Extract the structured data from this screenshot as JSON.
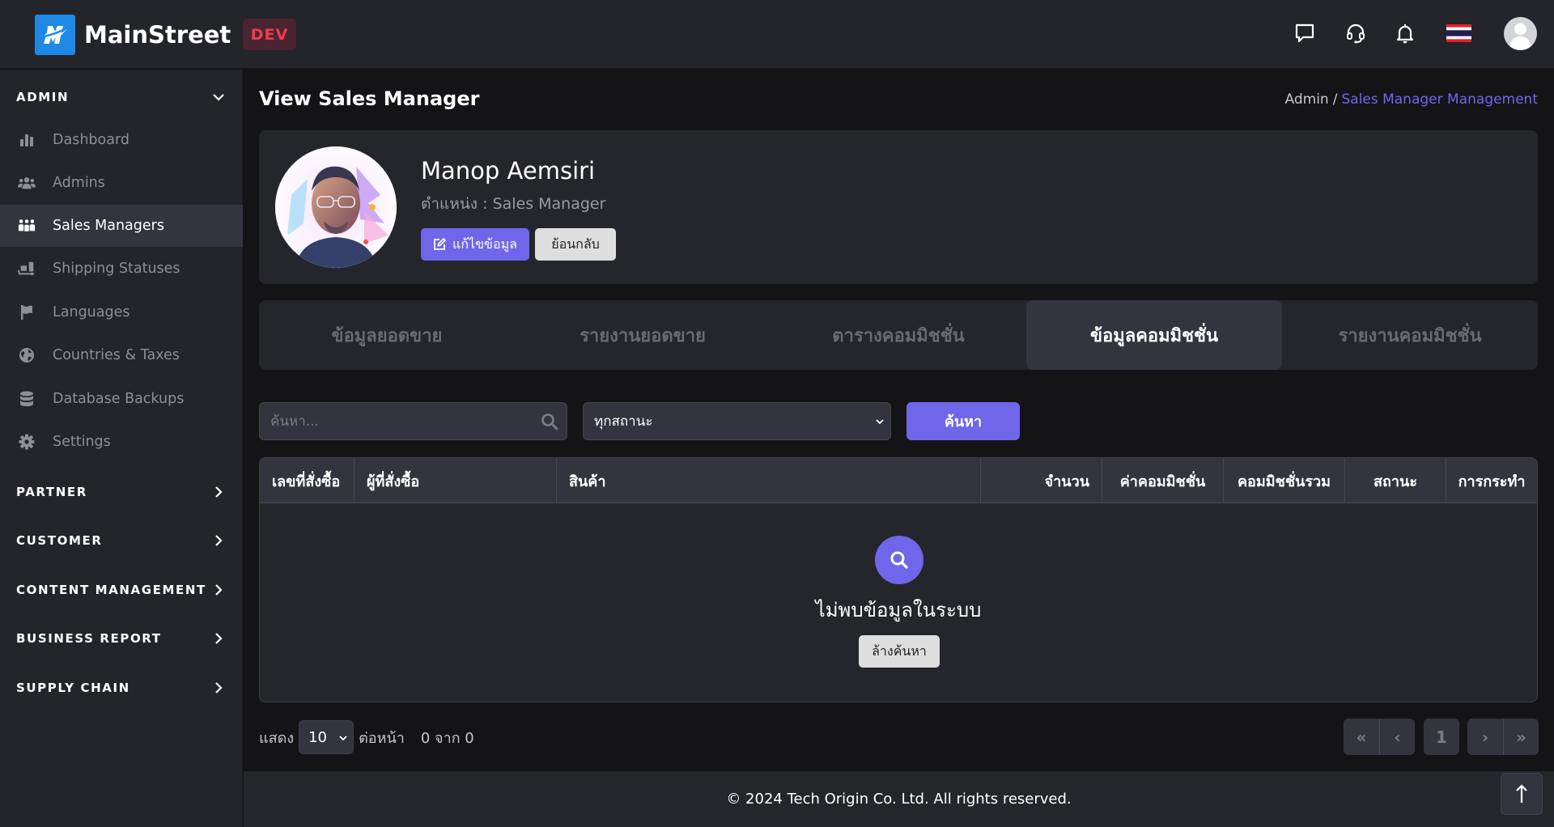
{
  "topbar": {
    "brand_name": "MainStreet",
    "env_badge": "DEV",
    "icons": [
      "chat-icon",
      "headset-support-icon",
      "bell-icon",
      "thai-flag-icon",
      "user-avatar"
    ]
  },
  "sidebar": {
    "sections": [
      {
        "label": "ADMIN",
        "expanded": true,
        "items": [
          {
            "label": "Dashboard",
            "icon": "bar-chart-icon",
            "active": false
          },
          {
            "label": "Admins",
            "icon": "users-icon",
            "active": false
          },
          {
            "label": "Sales Managers",
            "icon": "people-group-icon",
            "active": true
          },
          {
            "label": "Shipping Statuses",
            "icon": "dolly-icon",
            "active": false
          },
          {
            "label": "Languages",
            "icon": "flag-icon",
            "active": false
          },
          {
            "label": "Countries & Taxes",
            "icon": "globe-icon",
            "active": false
          },
          {
            "label": "Database Backups",
            "icon": "database-icon",
            "active": false
          },
          {
            "label": "Settings",
            "icon": "gear-icon",
            "active": false
          }
        ]
      },
      {
        "label": "PARTNER",
        "expanded": false
      },
      {
        "label": "CUSTOMER",
        "expanded": false
      },
      {
        "label": "CONTENT MANAGEMENT",
        "expanded": false
      },
      {
        "label": "BUSINESS REPORT",
        "expanded": false
      },
      {
        "label": "SUPPLY CHAIN",
        "expanded": false
      }
    ]
  },
  "page": {
    "title": "View Sales Manager",
    "breadcrumb": {
      "root": "Admin",
      "separator": "/",
      "current": "Sales Manager Management"
    }
  },
  "profile": {
    "name": "Manop Aemsiri",
    "role": "ตำแหน่ง : Sales Manager",
    "edit_label": "แก้ไขข้อมูล",
    "back_label": "ย้อนกลับ"
  },
  "tabs": [
    {
      "label": "ข้อมูลยอดขาย",
      "active": false
    },
    {
      "label": "รายงานยอดขาย",
      "active": false
    },
    {
      "label": "ตารางคอมมิชชั่น",
      "active": false
    },
    {
      "label": "ข้อมูลคอมมิชชั่น",
      "active": true
    },
    {
      "label": "รายงานคอมมิชชั่น",
      "active": false
    }
  ],
  "filters": {
    "search_placeholder": "ค้นหา...",
    "search_value": "",
    "status_selected": "ทุกสถานะ",
    "search_button": "ค้นหา"
  },
  "table": {
    "columns": [
      "เลขที่สั่งซื้อ",
      "ผู้ที่สั่งซื้อ",
      "สินค้า",
      "จำนวน",
      "ค่าคอมมิชชั่น",
      "คอมมิชชั่นรวม",
      "สถานะ",
      "การกระทำ"
    ],
    "rows": [],
    "empty_message": "ไม่พบข้อมูลในระบบ",
    "clear_button": "ล้างค้นหา"
  },
  "pagination": {
    "show_label": "แสดง",
    "page_size": "10",
    "per_page_label": "ต่อหน้า",
    "range_text": "0 จาก 0",
    "first": "«",
    "prev": "‹",
    "current_page": "1",
    "next": "›",
    "last": "»"
  },
  "footer": {
    "copyright": "© 2024 Tech Origin Co. Ltd. All rights reserved.",
    "back_to_top": "↑"
  },
  "colors": {
    "accent": "#6f66ea",
    "brand_blue": "#1e88e5",
    "dev_badge_text": "#ef3d4f",
    "sidebar_bg": "#24242b",
    "page_bg": "#141416"
  }
}
